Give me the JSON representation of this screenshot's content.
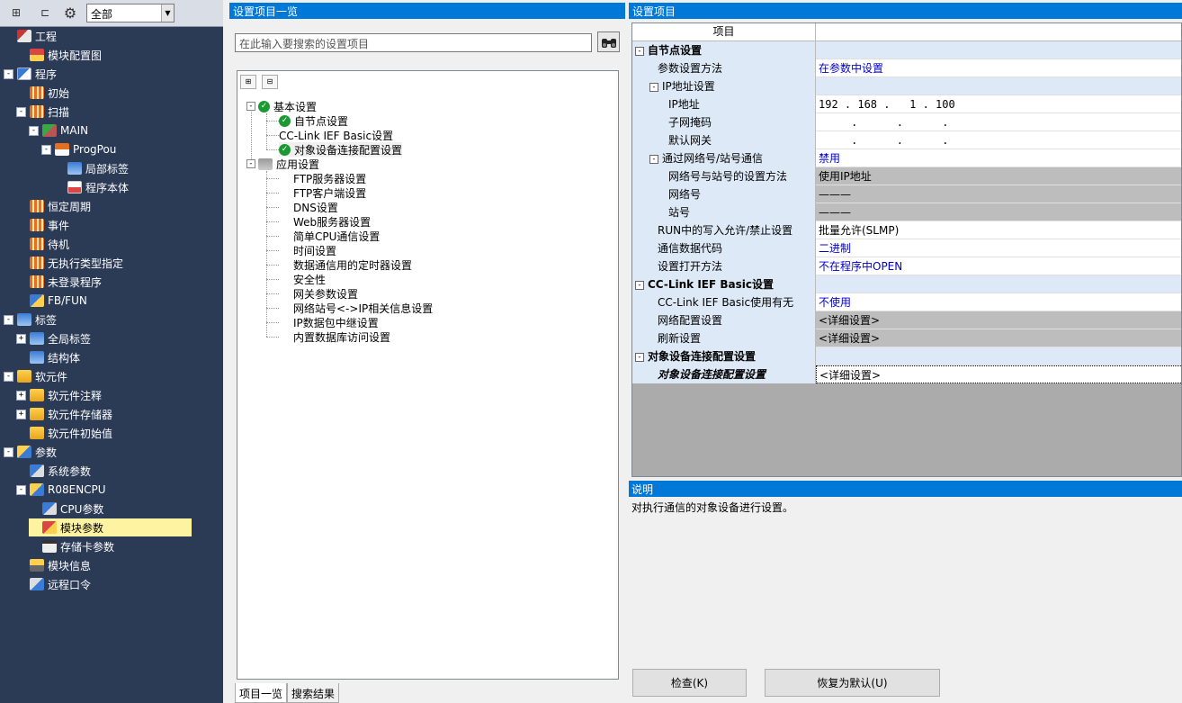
{
  "left_toolbar": {
    "filter_value": "全部"
  },
  "nav": [
    {
      "label": "工程",
      "icon": "project-icon",
      "level": 0
    },
    {
      "label": "模块配置图",
      "icon": "module-config-icon",
      "level": 1
    },
    {
      "label": "程序",
      "icon": "program-icon",
      "level": 0,
      "exp": "-"
    },
    {
      "label": "初始",
      "icon": "task-icon",
      "level": 1
    },
    {
      "label": "扫描",
      "icon": "task-icon",
      "level": 1,
      "exp": "-"
    },
    {
      "label": "MAIN",
      "icon": "main-icon",
      "level": 2,
      "exp": "-"
    },
    {
      "label": "ProgPou",
      "icon": "pou-icon",
      "level": 3,
      "exp": "-"
    },
    {
      "label": "局部标签",
      "icon": "label-icon",
      "level": 4
    },
    {
      "label": "程序本体",
      "icon": "body-icon",
      "level": 4
    },
    {
      "label": "恒定周期",
      "icon": "task-icon",
      "level": 1
    },
    {
      "label": "事件",
      "icon": "task-icon",
      "level": 1
    },
    {
      "label": "待机",
      "icon": "task-icon",
      "level": 1
    },
    {
      "label": "无执行类型指定",
      "icon": "task-icon",
      "level": 1
    },
    {
      "label": "未登录程序",
      "icon": "task-icon",
      "level": 1
    },
    {
      "label": "FB/FUN",
      "icon": "fb-icon",
      "level": 1
    },
    {
      "label": "标签",
      "icon": "label-icon",
      "level": 0,
      "exp": "-"
    },
    {
      "label": "全局标签",
      "icon": "label-icon",
      "level": 1,
      "exp": "+"
    },
    {
      "label": "结构体",
      "icon": "label-icon",
      "level": 1
    },
    {
      "label": "软元件",
      "icon": "device-icon",
      "level": 0,
      "exp": "-"
    },
    {
      "label": "软元件注释",
      "icon": "device-icon",
      "level": 1,
      "exp": "+"
    },
    {
      "label": "软元件存储器",
      "icon": "device-icon",
      "level": 1,
      "exp": "+"
    },
    {
      "label": "软元件初始值",
      "icon": "device-icon",
      "level": 1
    },
    {
      "label": "参数",
      "icon": "parameter-icon",
      "level": 0,
      "exp": "-"
    },
    {
      "label": "系统参数",
      "icon": "system-param-icon",
      "level": 1
    },
    {
      "label": "R08ENCPU",
      "icon": "parameter-icon",
      "level": 1,
      "exp": "-"
    },
    {
      "label": "CPU参数",
      "icon": "system-param-icon",
      "level": 2
    },
    {
      "label": "模块参数",
      "icon": "module-param-icon",
      "level": 2,
      "selected": true
    },
    {
      "label": "存储卡参数",
      "icon": "card-icon",
      "level": 2
    },
    {
      "label": "模块信息",
      "icon": "info-icon",
      "level": 1
    },
    {
      "label": "远程口令",
      "icon": "remote-icon",
      "level": 1
    }
  ],
  "mid": {
    "title": "设置项目一览",
    "search_placeholder": "在此输入要搜索的设置项目",
    "tree": {
      "basic": "基本设置",
      "basic_children": [
        "自节点设置",
        "CC-Link IEF Basic设置",
        "对象设备连接配置设置"
      ],
      "app": "应用设置",
      "app_children": [
        "FTP服务器设置",
        "FTP客户端设置",
        "DNS设置",
        "Web服务器设置",
        "简单CPU通信设置",
        "时间设置",
        "数据通信用的定时器设置",
        "安全性",
        "网关参数设置",
        "网络站号<->IP相关信息设置",
        "IP数据包中继设置",
        "内置数据库访问设置"
      ]
    },
    "tabs": [
      "项目一览",
      "搜索结果"
    ]
  },
  "right": {
    "title": "设置项目",
    "col_header": "项目",
    "rows": [
      {
        "name": "自节点设置",
        "value": "",
        "indent": 0,
        "type": "section",
        "exp": "-"
      },
      {
        "name": "参数设置方法",
        "value": "在参数中设置",
        "indent": 1,
        "type": "blue"
      },
      {
        "name": "IP地址设置",
        "value": "",
        "indent": 1,
        "type": "section-sub",
        "exp": "-"
      },
      {
        "name": "IP地址",
        "value": "192 . 168 .   1 . 100",
        "indent": 2,
        "type": "white"
      },
      {
        "name": "子网掩码",
        "value": "     .      .      .",
        "indent": 2,
        "type": "white"
      },
      {
        "name": "默认网关",
        "value": "     .      .      .",
        "indent": 2,
        "type": "white"
      },
      {
        "name": "通过网络号/站号通信",
        "value": "禁用",
        "indent": 1,
        "type": "blue",
        "exp": "-"
      },
      {
        "name": "网络号与站号的设置方法",
        "value": "使用IP地址",
        "indent": 2,
        "type": "gray"
      },
      {
        "name": "网络号",
        "value": "———",
        "indent": 2,
        "type": "gray"
      },
      {
        "name": "站号",
        "value": "———",
        "indent": 2,
        "type": "gray"
      },
      {
        "name": "RUN中的写入允许/禁止设置",
        "value": "批量允许(SLMP)",
        "indent": 1,
        "type": "white"
      },
      {
        "name": "通信数据代码",
        "value": "二进制",
        "indent": 1,
        "type": "blue"
      },
      {
        "name": "设置打开方法",
        "value": "不在程序中OPEN",
        "indent": 1,
        "type": "blue"
      },
      {
        "name": "CC-Link IEF Basic设置",
        "value": "",
        "indent": 0,
        "type": "section",
        "exp": "-"
      },
      {
        "name": "CC-Link IEF Basic使用有无",
        "value": "不使用",
        "indent": 1,
        "type": "blue"
      },
      {
        "name": "网络配置设置",
        "value": "<详细设置>",
        "indent": 1,
        "type": "gray"
      },
      {
        "name": "刷新设置",
        "value": "<详细设置>",
        "indent": 1,
        "type": "gray"
      },
      {
        "name": "对象设备连接配置设置",
        "value": "",
        "indent": 0,
        "type": "section",
        "exp": "-"
      },
      {
        "name": "对象设备连接配置设置",
        "value": "<详细设置>",
        "indent": 1,
        "type": "last"
      }
    ],
    "desc_title": "说明",
    "desc_text": "对执行通信的对象设备进行设置。",
    "check_button": "检查(K)",
    "reset_button": "恢复为默认(U)"
  }
}
